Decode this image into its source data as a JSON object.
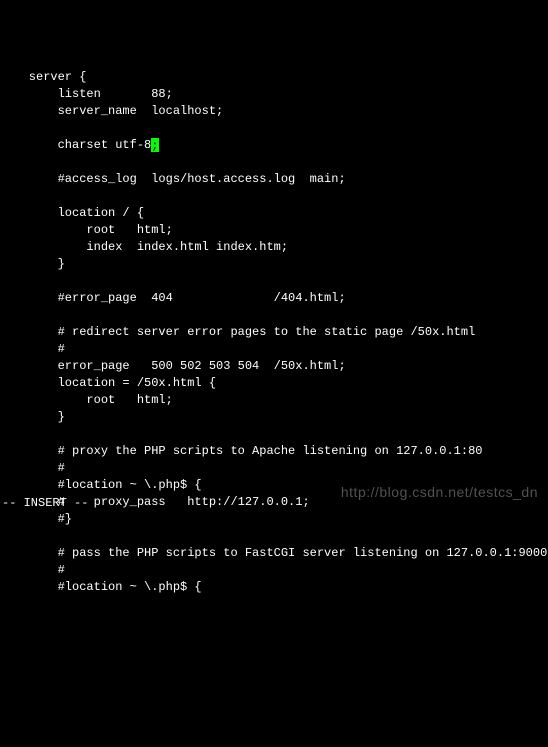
{
  "lines": [
    "    server {",
    "        listen       88;",
    "        server_name  localhost;",
    "",
    "        charset utf-8",
    "",
    "        #access_log  logs/host.access.log  main;",
    "",
    "        location / {",
    "            root   html;",
    "            index  index.html index.htm;",
    "        }",
    "",
    "        #error_page  404              /404.html;",
    "",
    "        # redirect server error pages to the static page /50x.html",
    "        #",
    "        error_page   500 502 503 504  /50x.html;",
    "        location = /50x.html {",
    "            root   html;",
    "        }",
    "",
    "        # proxy the PHP scripts to Apache listening on 127.0.0.1:80",
    "        #",
    "        #location ~ \\.php$ {",
    "        #    proxy_pass   http://127.0.0.1;",
    "        #}",
    "",
    "        # pass the PHP scripts to FastCGI server listening on 127.0.0.1:9000",
    "        #",
    "        #location ~ \\.php$ {"
  ],
  "cursor_line_index": 4,
  "cursor_suffix": ";",
  "status": "-- INSERT --",
  "watermark": "http://blog.csdn.net/testcs_dn"
}
